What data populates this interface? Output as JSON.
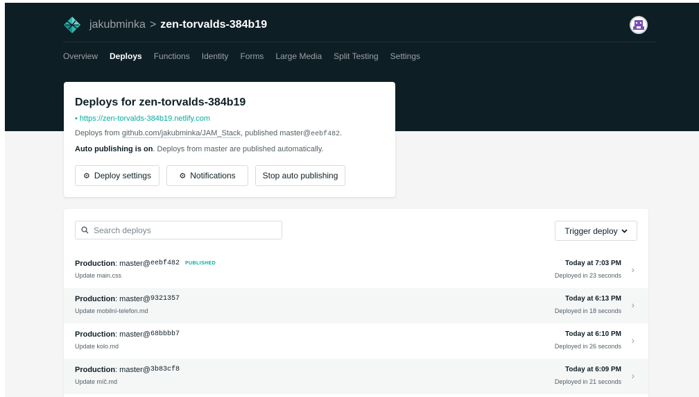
{
  "header": {
    "team": "jakubminka",
    "separator": ">",
    "site": "zen-torvalds-384b19"
  },
  "nav": {
    "tabs": [
      {
        "label": "Overview",
        "active": false
      },
      {
        "label": "Deploys",
        "active": true
      },
      {
        "label": "Functions",
        "active": false
      },
      {
        "label": "Identity",
        "active": false
      },
      {
        "label": "Forms",
        "active": false
      },
      {
        "label": "Large Media",
        "active": false
      },
      {
        "label": "Split Testing",
        "active": false
      },
      {
        "label": "Settings",
        "active": false
      }
    ]
  },
  "summary": {
    "title": "Deploys for zen-torvalds-384b19",
    "url": "https://zen-torvalds-384b19.netlify.com",
    "from_prefix": "Deploys from ",
    "repo": "github.com/jakubminka/JAM_Stack",
    "from_middle": ", published master@",
    "published_sha": "eebf482",
    "from_suffix": ".",
    "auto_on": "Auto publishing is on",
    "auto_rest": ". Deploys from master are published automatically.",
    "buttons": {
      "deploy_settings": "Deploy settings",
      "notifications": "Notifications",
      "stop_auto": "Stop auto publishing"
    }
  },
  "search": {
    "placeholder": "Search deploys"
  },
  "trigger": {
    "label": "Trigger deploy"
  },
  "deploys": [
    {
      "context": "Production",
      "branch": ": master@",
      "sha": "eebf482",
      "badge": "PUBLISHED",
      "message": "Update main.css",
      "time": "Today at 7:03 PM",
      "duration": "Deployed in 23 seconds"
    },
    {
      "context": "Production",
      "branch": ": master@",
      "sha": "9321357",
      "badge": "",
      "message": "Update mobilní-telefon.md",
      "time": "Today at 6:13 PM",
      "duration": "Deployed in 18 seconds"
    },
    {
      "context": "Production",
      "branch": ": master@",
      "sha": "68bbbb7",
      "badge": "",
      "message": "Update kolo.md",
      "time": "Today at 6:10 PM",
      "duration": "Deployed in 26 seconds"
    },
    {
      "context": "Production",
      "branch": ": master@",
      "sha": "3b83cf8",
      "badge": "",
      "message": "Update míč.md",
      "time": "Today at 6:09 PM",
      "duration": "Deployed in 21 seconds"
    }
  ],
  "colors": {
    "header_bg": "#0e1e25",
    "accent": "#00ad9f",
    "page_bg": "#f5f5f6"
  },
  "icons": [
    "netlify-logo-icon",
    "user-avatar-icon",
    "gear-icon",
    "search-icon",
    "chevron-down-icon",
    "chevron-right-icon"
  ]
}
